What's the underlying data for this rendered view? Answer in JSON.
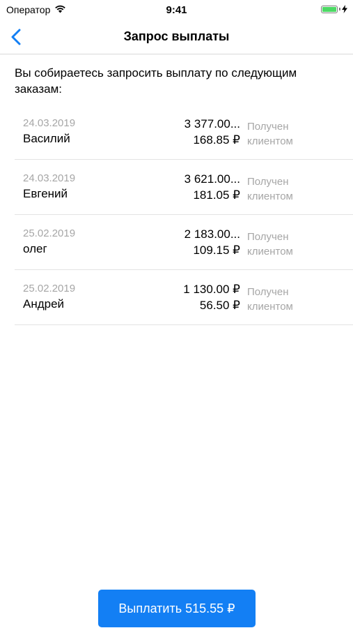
{
  "status_bar": {
    "carrier": "Оператор",
    "time": "9:41",
    "wifi_icon": "wifi-icon",
    "battery_icon": "battery-charging-icon",
    "battery_color": "#4cd964"
  },
  "nav": {
    "back_icon": "chevron-left-icon",
    "title": "Запрос выплаты"
  },
  "intro_text": "Вы собираетесь запросить выплату по следующим заказам:",
  "orders": [
    {
      "date": "24.03.2019",
      "name": "Василий",
      "amount": "3 377.00...",
      "payout": "168.85 ₽",
      "status": "Получен клиентом"
    },
    {
      "date": "24.03.2019",
      "name": "Евгений",
      "amount": "3 621.00...",
      "payout": "181.05 ₽",
      "status": "Получен клиентом"
    },
    {
      "date": "25.02.2019",
      "name": "олег",
      "amount": "2 183.00...",
      "payout": "109.15 ₽",
      "status": "Получен клиентом"
    },
    {
      "date": "25.02.2019",
      "name": "Андрей",
      "amount": "1 130.00 ₽",
      "payout": "56.50 ₽",
      "status": "Получен клиентом"
    }
  ],
  "payout_button_label": "Выплатить 515.55 ₽",
  "colors": {
    "accent": "#137ff4",
    "secondary_text": "#a6a6a6"
  }
}
